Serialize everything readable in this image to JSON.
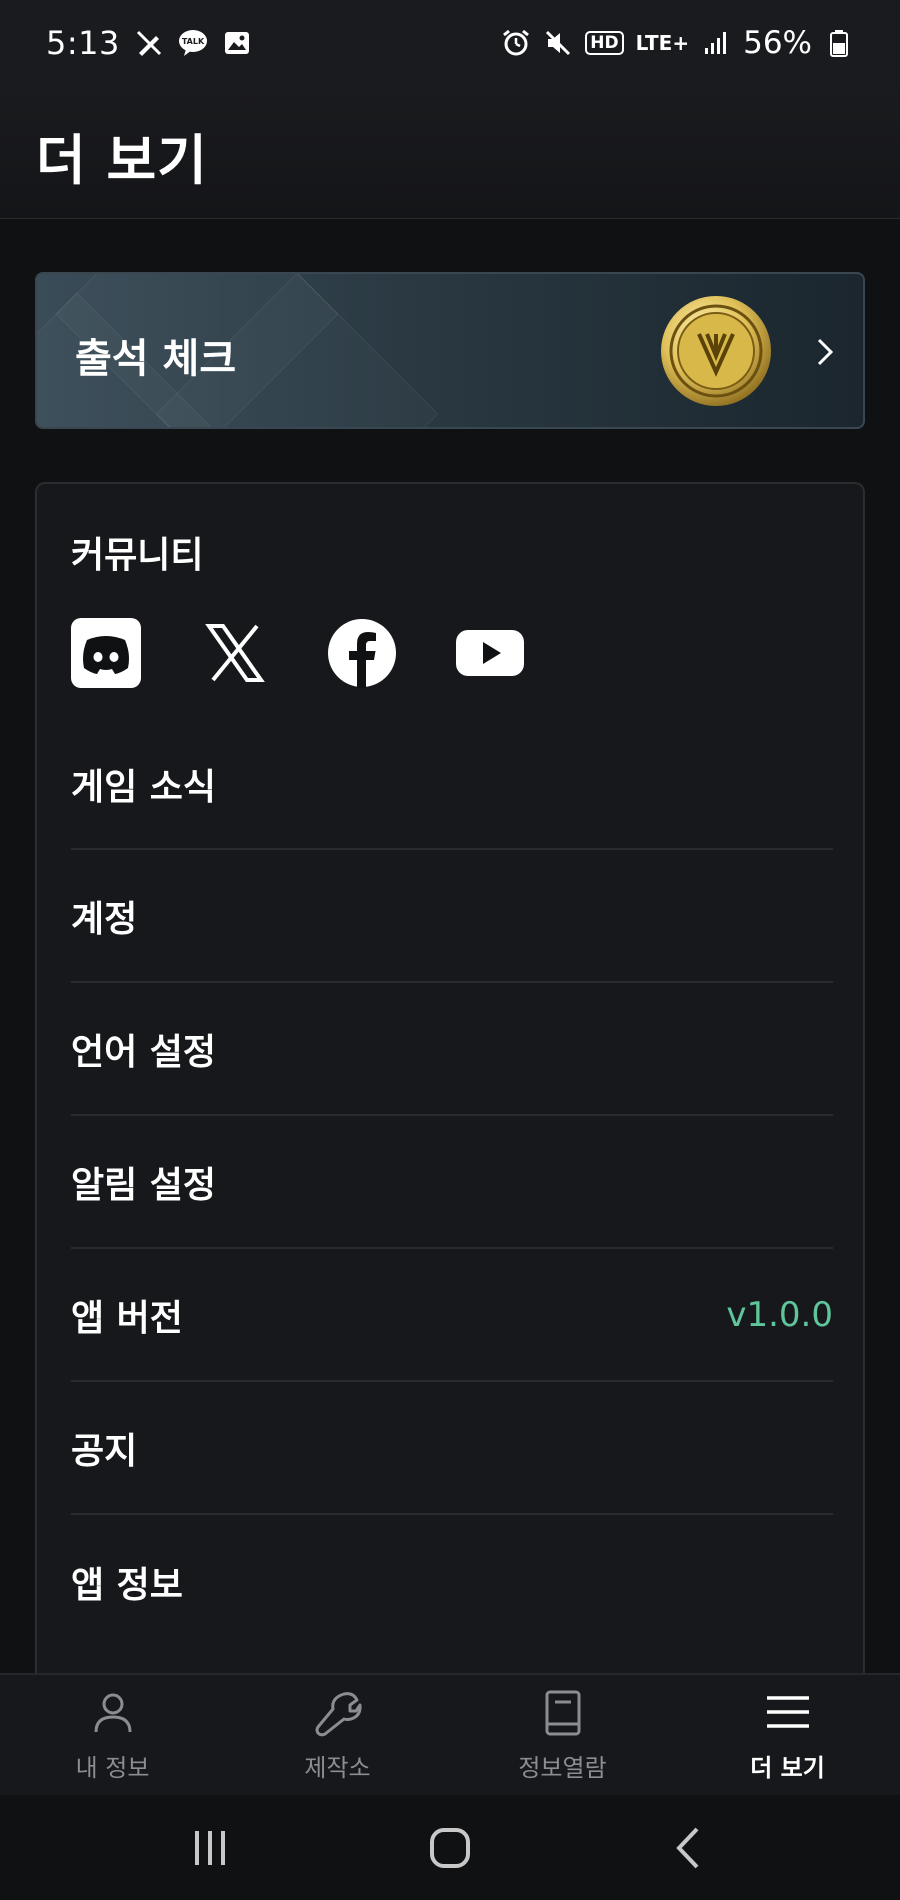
{
  "status_bar": {
    "time": "5:13",
    "left_icons": [
      "pen-off-icon",
      "talk-icon",
      "gallery-icon"
    ],
    "talk_label": "TALK",
    "hd_label": "HD",
    "network_label": "LTE+",
    "battery_percent": "56%"
  },
  "header": {
    "title": "더 보기"
  },
  "attendance": {
    "label": "출석 체크"
  },
  "community": {
    "title": "커뮤니티",
    "socials": [
      "discord-icon",
      "x-icon",
      "facebook-icon",
      "youtube-icon"
    ]
  },
  "menu": {
    "game_news": "게임 소식",
    "account": "계정",
    "language": "언어 설정",
    "notifications": "알림 설정",
    "app_version": "앱 버전",
    "app_version_value": "v1.0.0",
    "notice": "공지",
    "app_info": "앱 정보"
  },
  "bottom_nav": {
    "items": [
      {
        "label": "내 정보",
        "icon": "person-icon"
      },
      {
        "label": "제작소",
        "icon": "wrench-icon"
      },
      {
        "label": "정보열람",
        "icon": "book-icon"
      },
      {
        "label": "더 보기",
        "icon": "menu-icon",
        "active": true
      }
    ]
  },
  "colors": {
    "background": "#101113",
    "card": "#17181b",
    "accent_green": "#5fc59a",
    "inactive_text": "#8b8d93"
  }
}
